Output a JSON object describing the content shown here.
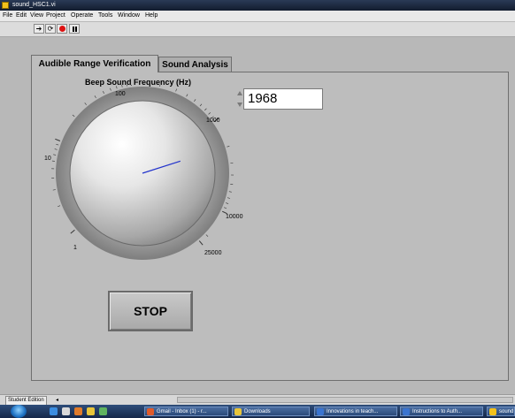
{
  "window": {
    "title": "sound_HSC1.vi"
  },
  "menu": {
    "items": [
      "File",
      "Edit",
      "View",
      "Project",
      "Operate",
      "Tools",
      "Window",
      "Help"
    ]
  },
  "toolbar": {
    "run_icon": "run-arrow-icon",
    "continuous_icon": "run-continuously-icon",
    "abort_icon": "abort-icon",
    "pause_icon": "pause-icon"
  },
  "tabs": [
    {
      "label": "Audible Range Verification",
      "active": true
    },
    {
      "label": "Sound Analysis",
      "active": false
    }
  ],
  "knob": {
    "label": "Beep Sound Frequency (Hz)",
    "scale": "log",
    "min": 1,
    "max": 25000,
    "value": 1968,
    "tick_labels": [
      "1",
      "10",
      "100",
      "1000",
      "10000",
      "25000"
    ],
    "needle_color": "#2233cc"
  },
  "numeric": {
    "value": "1968"
  },
  "stop_button": {
    "label": "STOP"
  },
  "status": {
    "edition": "Student Edition"
  },
  "taskbar": {
    "items": [
      {
        "label": "Gmail - Inbox (1) - r..."
      },
      {
        "label": "Downloads"
      },
      {
        "label": "Innovations in teach..."
      },
      {
        "label": "Instructions to Auth..."
      },
      {
        "label": "sound"
      }
    ]
  }
}
